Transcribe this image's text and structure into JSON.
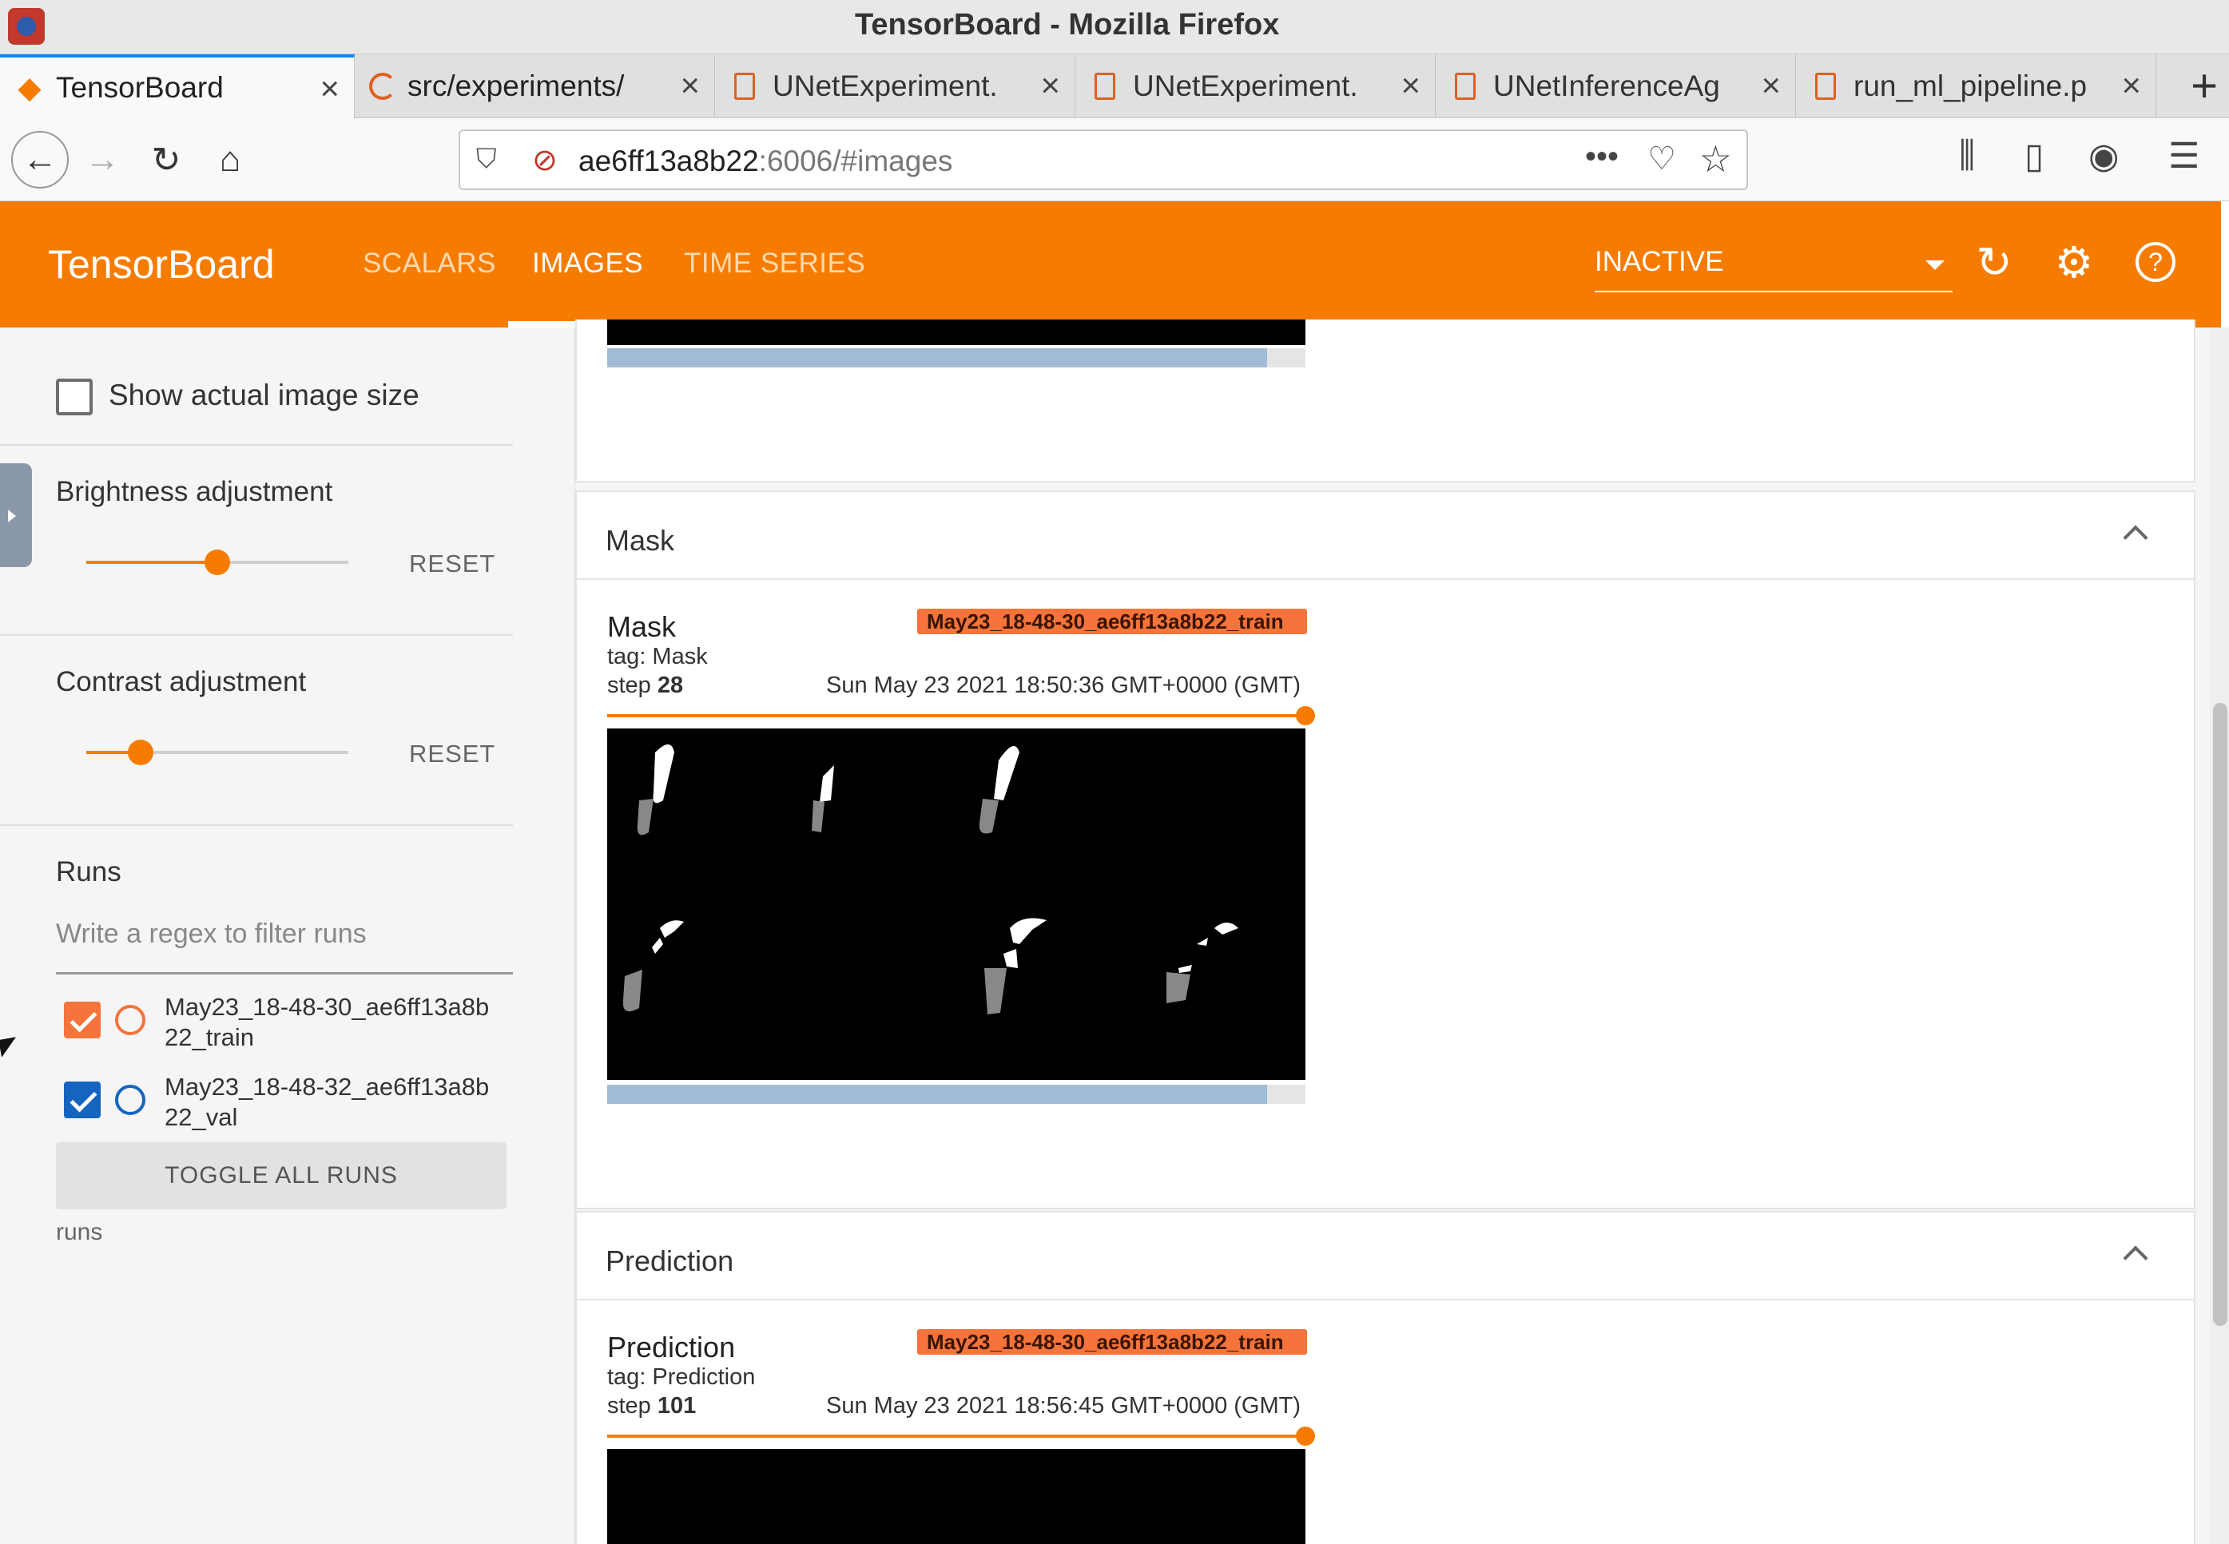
{
  "window": {
    "title": "TensorBoard - Mozilla Firefox"
  },
  "tabs": [
    {
      "label": "TensorBoard",
      "icon": "tensorboard-icon",
      "active": true
    },
    {
      "label": "src/experiments/",
      "icon": "loading-spinner-icon",
      "active": false
    },
    {
      "label": "UNetExperiment.",
      "icon": "document-icon",
      "active": false
    },
    {
      "label": "UNetExperiment.",
      "icon": "document-icon",
      "active": false
    },
    {
      "label": "UNetInferenceAg",
      "icon": "document-icon",
      "active": false
    },
    {
      "label": "run_ml_pipeline.p",
      "icon": "document-icon",
      "active": false
    }
  ],
  "new_tab_label": "+",
  "url": {
    "host": "ae6ff13a8b22",
    "rest": ":6006/#images"
  },
  "toolbar_icons": [
    "library-icon",
    "sidebar-icon",
    "account-icon",
    "menu-icon"
  ],
  "header": {
    "brand": "TensorBoard",
    "nav": [
      "SCALARS",
      "IMAGES",
      "TIME SERIES"
    ],
    "active_nav": "IMAGES",
    "run_status": "INACTIVE",
    "accent_color": "#f57c00"
  },
  "sidebar": {
    "show_actual_size_label": "Show actual image size",
    "brightness_label": "Brightness adjustment",
    "brightness_value": 0.5,
    "contrast_label": "Contrast adjustment",
    "contrast_value": 0.2,
    "reset_label": "RESET",
    "runs_heading": "Runs",
    "filter_placeholder": "Write a regex to filter runs",
    "runs": [
      {
        "name_line1": "May23_18-48-30_ae6ff13a8b",
        "name_line2": "22_train",
        "color": "#f4743b",
        "checked": true
      },
      {
        "name_line1": "May23_18-48-32_ae6ff13a8b",
        "name_line2": "22_val",
        "color": "#1565c0",
        "checked": true
      }
    ],
    "toggle_all_label": "TOGGLE ALL RUNS",
    "footer_label": "runs"
  },
  "sections": [
    {
      "title": "Mask",
      "card": {
        "title": "Mask",
        "tag": "tag: Mask",
        "step_prefix": "step",
        "step": "28",
        "timestamp": "Sun May 23 2021 18:50:36 GMT+0000 (GMT)",
        "run": "May23_18-48-30_ae6ff13a8b22_train"
      }
    },
    {
      "title": "Prediction",
      "card": {
        "title": "Prediction",
        "tag": "tag: Prediction",
        "step_prefix": "step",
        "step": "101",
        "timestamp": "Sun May 23 2021 18:56:45 GMT+0000 (GMT)",
        "run": "May23_18-48-30_ae6ff13a8b22_train"
      }
    }
  ]
}
